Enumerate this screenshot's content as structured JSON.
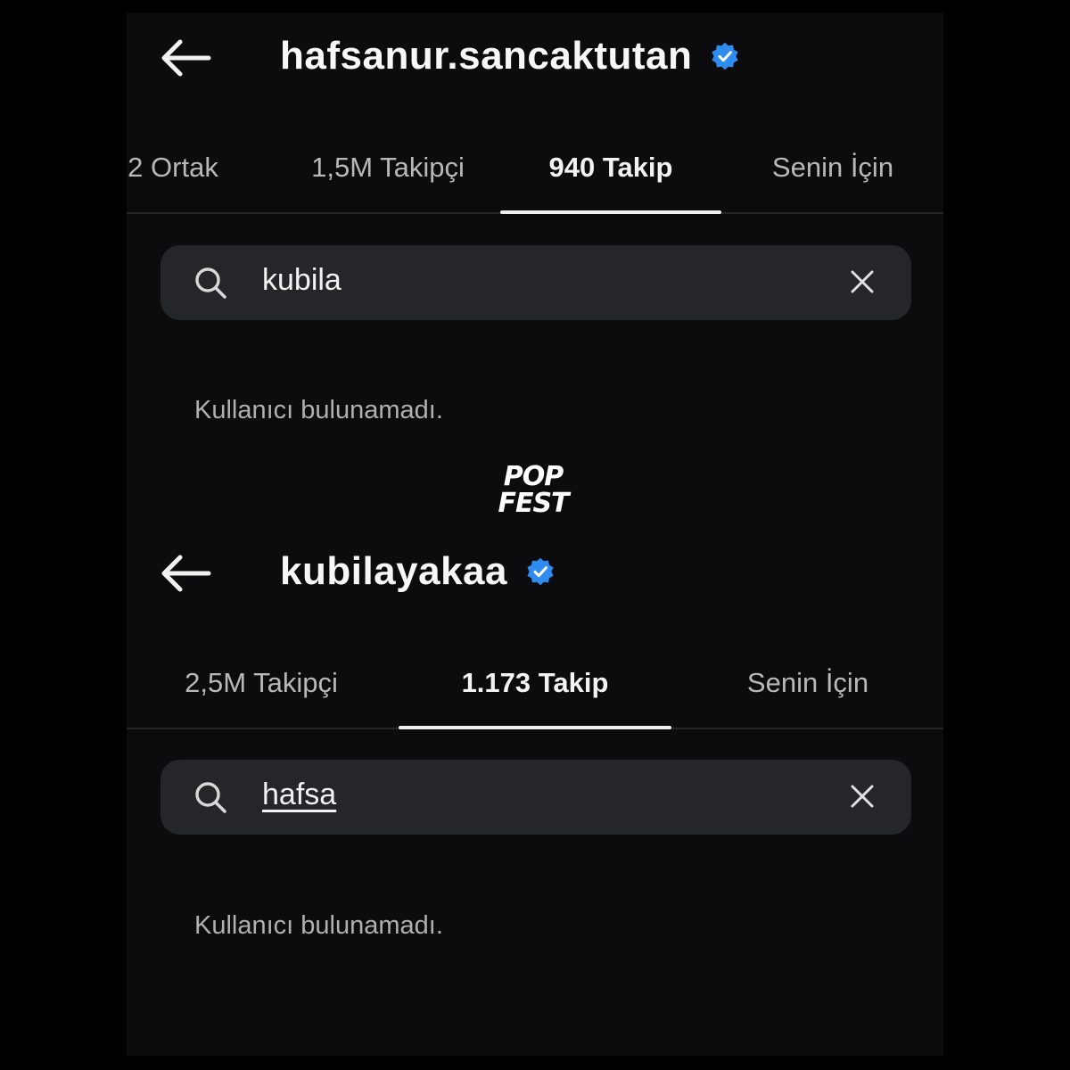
{
  "top_screen": {
    "username": "hafsanur.sancaktutan",
    "tabs": [
      {
        "label": "2 Ortak",
        "active": false
      },
      {
        "label": "1,5M Takipçi",
        "active": false
      },
      {
        "label": "940 Takip",
        "active": true
      },
      {
        "label": "Senin İçin",
        "active": false
      }
    ],
    "search": {
      "value": "kubila"
    },
    "empty_message": "Kullanıcı bulunamadı."
  },
  "bottom_screen": {
    "username": "kubilayakaa",
    "tabs": [
      {
        "label": "2,5M Takipçi",
        "active": false
      },
      {
        "label": "1.173 Takip",
        "active": true
      },
      {
        "label": "Senin İçin",
        "active": false
      }
    ],
    "search": {
      "value": "hafsa"
    },
    "empty_message": "Kullanıcı bulunamadı."
  },
  "watermark": {
    "line1": "POP",
    "line2": "FEST"
  },
  "icons": {
    "back": "arrow-left-icon",
    "verified": "verified-badge-icon",
    "search": "search-icon",
    "clear": "close-icon"
  },
  "colors": {
    "verified_blue": "#2e8cf0",
    "background": "#0c0c0f",
    "search_bg": "#242629"
  }
}
